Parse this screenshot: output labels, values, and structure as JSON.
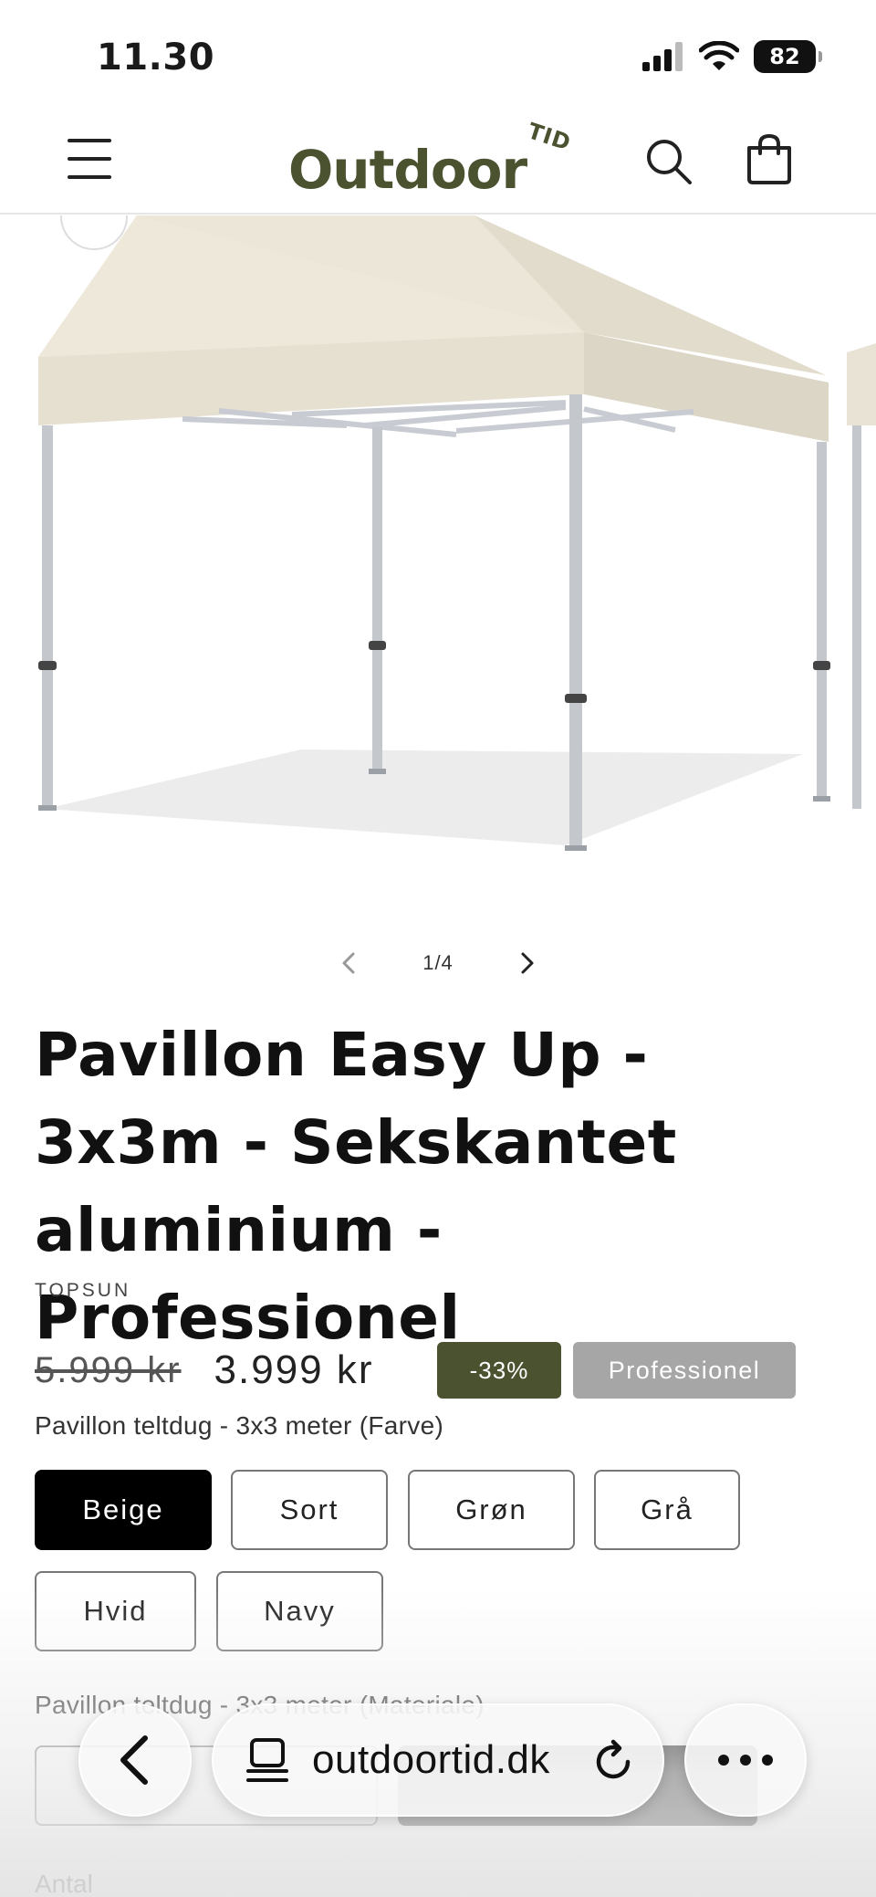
{
  "status_bar": {
    "time": "11.30",
    "battery": "82"
  },
  "header": {
    "logo_text": "Outdoor",
    "logo_suffix": "TID"
  },
  "gallery": {
    "counter": "1/4"
  },
  "product": {
    "title": "Pavillon Easy Up - 3x3m - Sekskantet aluminium - Professionel",
    "vendor": "TOPSUN",
    "price_old": "5.999 kr",
    "price_new": "3.999 kr",
    "badge_sale": "-33%",
    "badge_tag": "Professionel"
  },
  "options": {
    "color_label": "Pavillon teltdug - 3x3 meter (Farve)",
    "colors": [
      "Beige",
      "Sort",
      "Grøn",
      "Grå",
      "Hvid",
      "Navy"
    ],
    "selected_color": "Beige",
    "material_label": "Pavillon teltdug - 3x3 meter (Materiale)"
  },
  "quantity": {
    "label": "Antal"
  },
  "browser": {
    "url": "outdoortid.dk"
  },
  "colors": {
    "brand_green": "#4a5230",
    "tag_gray": "#a6a6a6",
    "canopy_beige": "#ece6d8"
  }
}
